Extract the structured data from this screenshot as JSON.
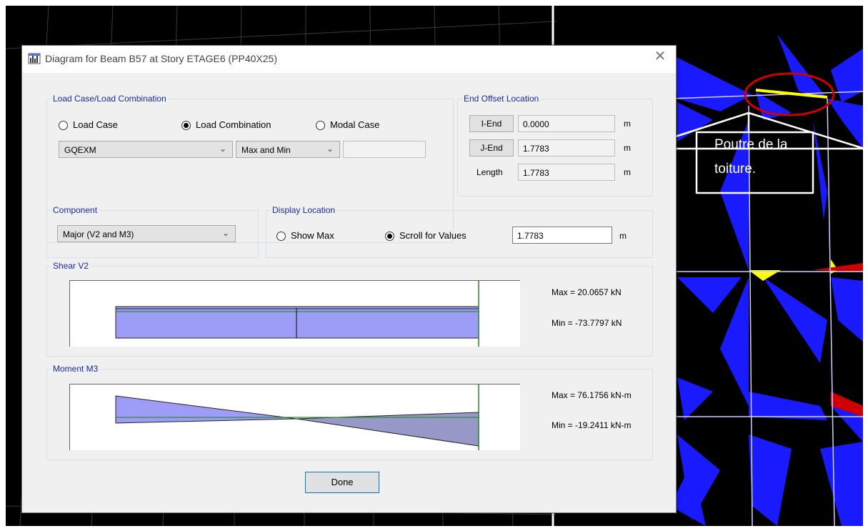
{
  "window": {
    "title": "Diagram for Beam B57 at Story ETAGE6 (PP40X25)",
    "close_glyph": "✕"
  },
  "load_case_group": {
    "title": "Load Case/Load Combination",
    "radios": [
      {
        "label": "Load Case",
        "checked": false
      },
      {
        "label": "Load Combination",
        "checked": true
      },
      {
        "label": "Modal Case",
        "checked": false
      }
    ],
    "combo_value": "GQEXM",
    "envelope_value": "Max and Min",
    "extra_value": ""
  },
  "end_offset_group": {
    "title": "End Offset Location",
    "i_end_label": "I-End",
    "i_end_value": "0.0000",
    "j_end_label": "J-End",
    "j_end_value": "1.7783",
    "length_label": "Length",
    "length_value": "1.7783",
    "unit": "m"
  },
  "component_group": {
    "title": "Component",
    "value": "Major (V2 and M3)"
  },
  "display_location_group": {
    "title": "Display Location",
    "radios": [
      {
        "label": "Show Max",
        "checked": false
      },
      {
        "label": "Scroll for Values",
        "checked": true
      }
    ],
    "value": "1.7783",
    "unit": "m"
  },
  "shear_group": {
    "title": "Shear V2",
    "max_text": "Max = 20.0657 kN",
    "min_text": "Min = -73.7797 kN"
  },
  "moment_group": {
    "title": "Moment M3",
    "max_text": "Max = 76.1756 kN-m",
    "min_text": "Min = -19.2411 kN-m"
  },
  "done_label": "Done",
  "callout": {
    "line1": "Poutre de la",
    "line2": "toiture."
  },
  "colors": {
    "diagram_fill": "#9d9df7",
    "diagram_fill_dark": "#9898c8",
    "axis_line": "#2f8f2f",
    "group_title": "#1a2aa8",
    "model_blue": "#1a1aff",
    "highlight_circle": "#d00000"
  },
  "icons": [
    "app-icon",
    "close-icon",
    "chevron-down-icon"
  ]
}
